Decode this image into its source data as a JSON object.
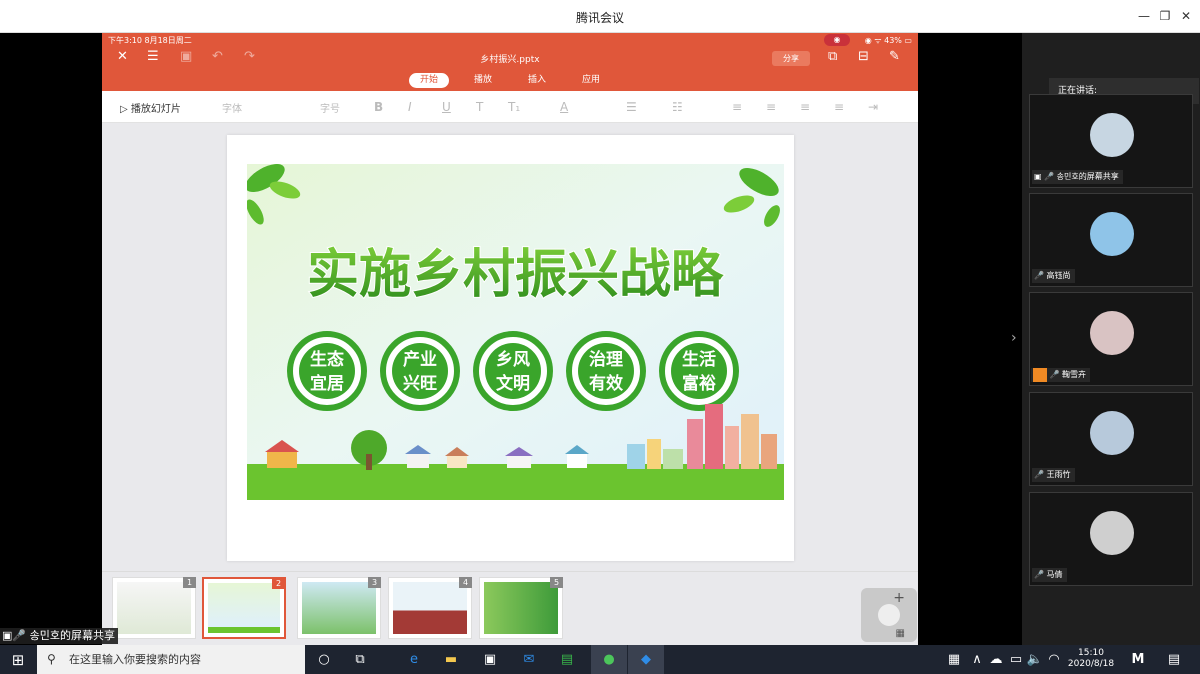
{
  "window": {
    "title": "腾讯会议",
    "minimize": "—",
    "restore": "❐",
    "close": "✕"
  },
  "phone_status": {
    "time_date": "下午3:10   8月18日周二",
    "battery": "43%",
    "record": "◉"
  },
  "app": {
    "filename": "乡村振兴.pptx",
    "share_label": "分享",
    "tabs": [
      "开始",
      "播放",
      "插入",
      "应用"
    ],
    "active_tab": "开始",
    "toolbar": {
      "play_label": "播放幻灯片",
      "font_placeholder": "字体",
      "size_placeholder": "字号",
      "bold": "B",
      "italic": "I",
      "underline": "U",
      "strike": "T",
      "sub": "T₁",
      "color": "A"
    }
  },
  "slide": {
    "title": "实施乡村振兴战略",
    "circles": [
      {
        "line1": "生态",
        "line2": "宜居"
      },
      {
        "line1": "产业",
        "line2": "兴旺"
      },
      {
        "line1": "乡风",
        "line2": "文明"
      },
      {
        "line1": "治理",
        "line2": "有效"
      },
      {
        "line1": "生活",
        "line2": "富裕"
      }
    ]
  },
  "thumbnails": [
    {
      "num": "1",
      "selected": false
    },
    {
      "num": "2",
      "selected": true
    },
    {
      "num": "3",
      "selected": false
    },
    {
      "num": "4",
      "selected": false
    },
    {
      "num": "5",
      "selected": false
    }
  ],
  "meeting": {
    "speaking_label": "正在讲话:",
    "participants": [
      {
        "name": "송민호的屏幕共享",
        "avatar_color": "#c7d6e2"
      },
      {
        "name": "高钰尚",
        "avatar_color": "#8fc4e8"
      },
      {
        "name": "鞠雪卉",
        "avatar_color": "#d9c3c3"
      },
      {
        "name": "王雨竹",
        "avatar_color": "#b7c9db"
      },
      {
        "name": "马倩",
        "avatar_color": "#cfcfcf"
      }
    ],
    "share_overlay_label": "송민호的屏幕共享"
  },
  "taskbar": {
    "search_placeholder": "在这里输入你要搜索的内容",
    "time": "15:10",
    "date": "2020/8/18"
  },
  "colors": {
    "accent": "#e0573a",
    "green": "#3aa52b"
  }
}
